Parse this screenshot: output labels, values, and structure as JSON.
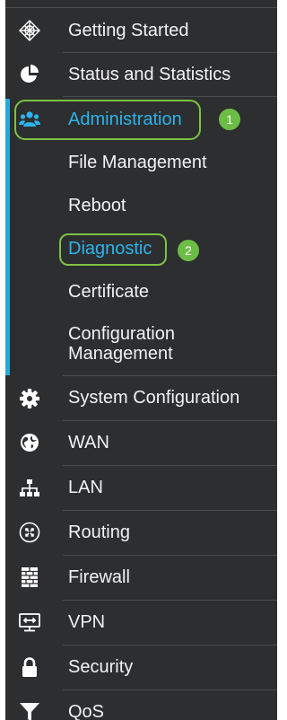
{
  "sidebar": {
    "items": [
      {
        "label": "Getting Started",
        "icon": "globe-grid-icon"
      },
      {
        "label": "Status and Statistics",
        "icon": "pie-chart-icon"
      },
      {
        "label": "Administration",
        "icon": "users-icon"
      },
      {
        "label": "System Configuration",
        "icon": "gear-icon"
      },
      {
        "label": "WAN",
        "icon": "globe-icon"
      },
      {
        "label": "LAN",
        "icon": "network-tree-icon"
      },
      {
        "label": "Routing",
        "icon": "routing-arrows-icon"
      },
      {
        "label": "Firewall",
        "icon": "brick-wall-icon"
      },
      {
        "label": "VPN",
        "icon": "vpn-monitor-icon"
      },
      {
        "label": "Security",
        "icon": "lock-icon"
      },
      {
        "label": "QoS",
        "icon": "filter-funnel-icon"
      }
    ],
    "submenu": [
      {
        "label": "File Management"
      },
      {
        "label": "Reboot"
      },
      {
        "label": "Diagnostic"
      },
      {
        "label": "Certificate"
      },
      {
        "label": "Configuration Management"
      }
    ]
  },
  "callouts": [
    "1",
    "2"
  ],
  "colors": {
    "background": "#2d2e30",
    "text": "#f2f2f2",
    "active_text": "#2db4ec",
    "active_bar": "#2aa8d8",
    "highlight": "#7cc243",
    "badge": "#6cbd45"
  }
}
